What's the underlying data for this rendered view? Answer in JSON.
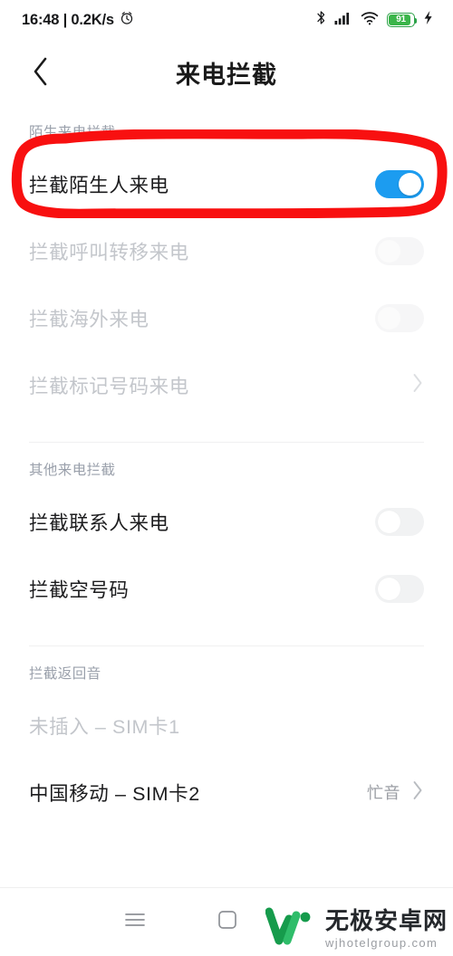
{
  "status_bar": {
    "time_and_speed": "16:48 | 0.2K/s",
    "alarm_icon": "alarm-clock-icon",
    "bluetooth_icon": "bluetooth-icon",
    "signal_icon": "cellular-signal-icon",
    "wifi_icon": "wifi-icon",
    "battery_level": "91",
    "charging_icon": "charging-bolt-icon",
    "battery_color": "#3bb54a"
  },
  "header": {
    "back_icon": "back-chevron-icon",
    "title": "来电拦截"
  },
  "sections": [
    {
      "id": "stranger",
      "header": "陌生来电拦截",
      "rows": [
        {
          "label": "拦截陌生人来电",
          "control": "toggle",
          "state": "on",
          "enabled": true,
          "highlighted": true
        },
        {
          "label": "拦截呼叫转移来电",
          "control": "toggle",
          "state": "off",
          "enabled": false
        },
        {
          "label": "拦截海外来电",
          "control": "toggle",
          "state": "off",
          "enabled": false
        },
        {
          "label": "拦截标记号码来电",
          "control": "chevron",
          "enabled": false
        }
      ]
    },
    {
      "id": "other",
      "header": "其他来电拦截",
      "rows": [
        {
          "label": "拦截联系人来电",
          "control": "toggle",
          "state": "off",
          "enabled": true
        },
        {
          "label": "拦截空号码",
          "control": "toggle",
          "state": "off",
          "enabled": true
        }
      ]
    },
    {
      "id": "tone",
      "header": "拦截返回音",
      "rows": [
        {
          "label": "未插入 – SIM卡1",
          "control": "none",
          "enabled": false
        },
        {
          "label": "中国移动 – SIM卡2",
          "control": "chevron",
          "value": "忙音",
          "enabled": true
        }
      ]
    }
  ],
  "annotation": {
    "shape": "hand-drawn-rounded-rectangle",
    "color": "#f81010",
    "targets": "拦截陌生人来电"
  },
  "nav_bar": {
    "recents_icon": "menu-recents-icon",
    "home_icon": "home-square-icon"
  },
  "watermark": {
    "logo_icon": "w-logo-icon",
    "site_name": "无极安卓网",
    "site_url": "wjhotelgroup.com",
    "logo_color": "#1aab4f"
  },
  "colors": {
    "toggle_on": "#1c9cf0",
    "toggle_off": "#f1f2f3",
    "section_header": "#9aa0ab",
    "label": "#1c1c1e",
    "label_disabled": "#c3c6cb"
  }
}
